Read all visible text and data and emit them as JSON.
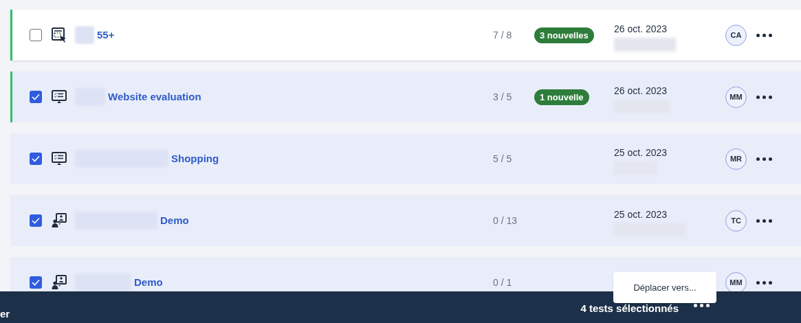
{
  "rows": [
    {
      "selected": false,
      "accent": true,
      "kind": "prototype",
      "name": "55+",
      "count": "7 / 8",
      "badge": "3 nouvelles",
      "date": "26 oct. 2023",
      "avatar": "CA"
    },
    {
      "selected": true,
      "accent": true,
      "kind": "website",
      "name": "Website evaluation",
      "count": "3 / 5",
      "badge": "1 nouvelle",
      "date": "26 oct. 2023",
      "avatar": "MM"
    },
    {
      "selected": true,
      "accent": false,
      "kind": "website",
      "name": "Shopping",
      "count": "5 / 5",
      "date": "25 oct. 2023",
      "avatar": "MR"
    },
    {
      "selected": true,
      "accent": false,
      "kind": "moderated",
      "name": "Demo",
      "count": "0 / 13",
      "date": "25 oct. 2023",
      "avatar": "TC"
    },
    {
      "selected": true,
      "accent": false,
      "kind": "moderated",
      "name": "Demo",
      "count": "0 / 1",
      "avatar": "MM"
    }
  ],
  "bottom_bar": {
    "left_text": "er",
    "selection_text": "4 tests sélectionnés"
  },
  "popup": {
    "item": "Déplacer vers..."
  }
}
